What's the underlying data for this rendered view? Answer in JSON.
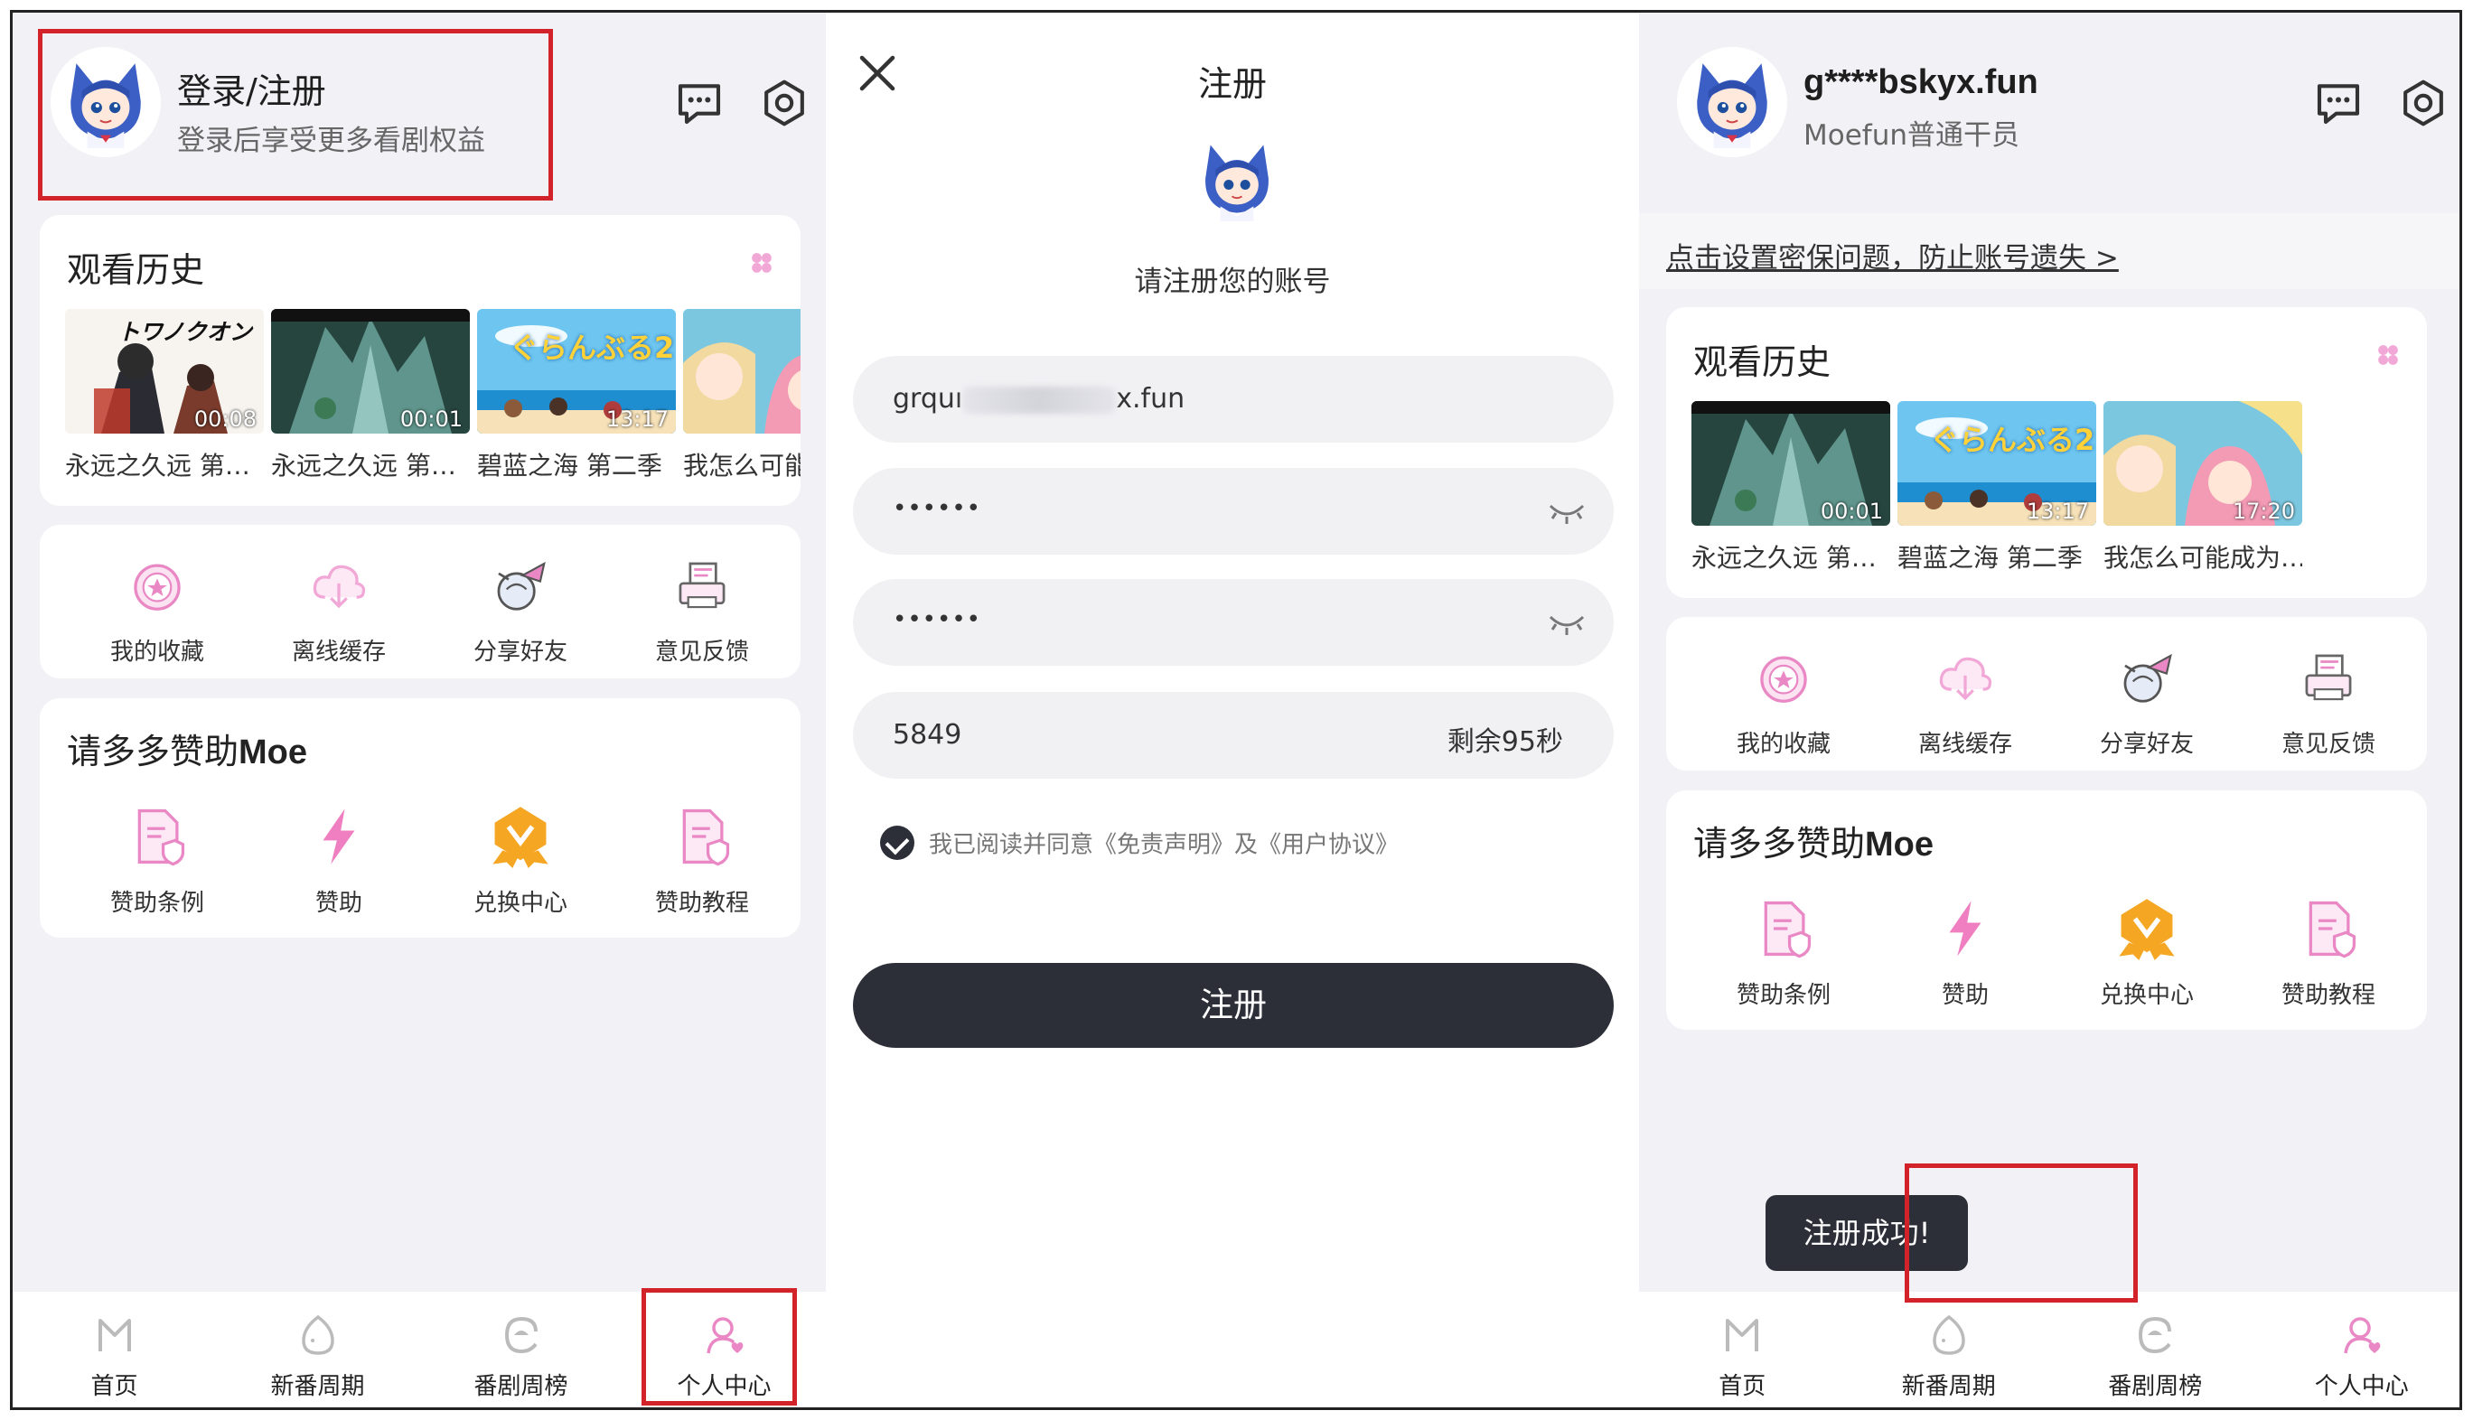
{
  "panel_left": {
    "header": {
      "title": "登录/注册",
      "subtitle": "登录后享受更多看剧权益"
    },
    "history": {
      "title": "观看历史",
      "items": [
        {
          "caption": "永远之久远 第…",
          "time": "00:08",
          "art_title": "トワノクオン"
        },
        {
          "caption": "永远之久远 第…",
          "time": "00:01"
        },
        {
          "caption": "碧蓝之海 第二季",
          "time": "13:17",
          "art_title": "ぐらんぶる2"
        },
        {
          "caption": "我怎么可能",
          "time": ""
        }
      ]
    },
    "actions": [
      "我的收藏",
      "离线缓存",
      "分享好友",
      "意见反馈"
    ],
    "support": {
      "title_prefix": "请多多赞助",
      "title_brand": "Moe",
      "items": [
        "赞助条例",
        "赞助",
        "兑换中心",
        "赞助教程"
      ]
    },
    "nav": [
      "首页",
      "新番周期",
      "番剧周榜",
      "个人中心"
    ]
  },
  "panel_register": {
    "title": "注册",
    "subtitle": "请注册您的账号",
    "email_prefix": "grquı",
    "email_suffix": "x.fun",
    "password": "••••••",
    "password_confirm": "••••••",
    "code": "5849",
    "countdown": "剩余95秒",
    "agree_text": "我已阅读并同意《免责声明》及《用户协议》",
    "submit": "注册"
  },
  "panel_right": {
    "header": {
      "title": "g****bskyx.fun",
      "subtitle": "Moefun普通干员"
    },
    "security_link": "点击设置密保问题，防止账号遗失 >",
    "history": {
      "title": "观看历史",
      "items": [
        {
          "caption": "永远之久远 第…",
          "time": "00:01"
        },
        {
          "caption": "碧蓝之海 第二季",
          "time": "13:17",
          "art_title": "ぐらんぶる2"
        },
        {
          "caption": "我怎么可能成为…",
          "time": "17:20"
        }
      ]
    },
    "actions": [
      "我的收藏",
      "离线缓存",
      "分享好友",
      "意见反馈"
    ],
    "support": {
      "title_prefix": "请多多赞助",
      "title_brand": "Moe",
      "items": [
        "赞助条例",
        "赞助",
        "兑换中心",
        "赞助教程"
      ]
    },
    "toast": "注册成功!",
    "nav": [
      "首页",
      "新番周期",
      "番剧周榜",
      "个人中心"
    ]
  },
  "colors": {
    "accent_pink": "#e988c4",
    "dark_button": "#2d2f38",
    "highlight_red": "#d2222a",
    "gold": "#f5a623"
  },
  "icons": {
    "header": [
      "chat-icon",
      "settings-icon"
    ],
    "actions": [
      "favorite-icon",
      "cloud-download-icon",
      "share-icon",
      "feedback-icon"
    ],
    "support": [
      "document-icon",
      "lightning-icon",
      "badge-icon",
      "tutorial-icon"
    ],
    "nav": [
      "home-icon",
      "egg-icon",
      "ranking-icon",
      "user-icon"
    ]
  }
}
